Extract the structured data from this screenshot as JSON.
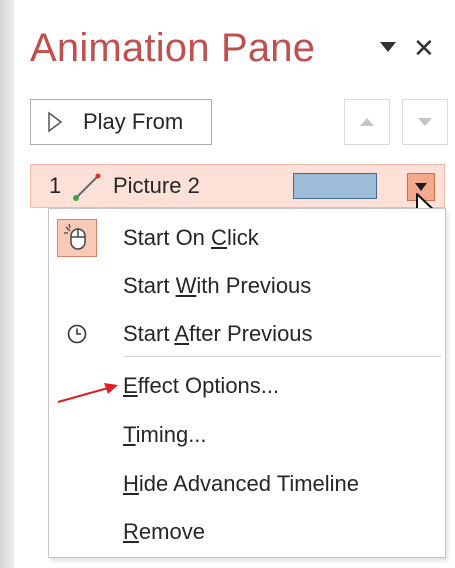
{
  "pane": {
    "title": "Animation Pane",
    "accent_color": "#c0504d"
  },
  "toolbar": {
    "play_label": "Play From",
    "move_up_icon": "triangle-up-icon",
    "move_down_icon": "triangle-down-icon"
  },
  "effect": {
    "number": "1",
    "icon": "motion-path-icon",
    "name": "Picture 2",
    "row_color": "#fde1d8",
    "timeline_color": "#9dbcd8"
  },
  "menu": {
    "items": [
      {
        "pre": "Start On ",
        "key": "C",
        "post": "lick",
        "icon": "mouse-click-icon",
        "checked": true
      },
      {
        "pre": "Start ",
        "key": "W",
        "post": "ith Previous",
        "icon": "",
        "checked": false
      },
      {
        "pre": "Start ",
        "key": "A",
        "post": "fter Previous",
        "icon": "clock-icon",
        "checked": false
      },
      {
        "pre": "",
        "key": "E",
        "post": "ffect Options...",
        "icon": "",
        "checked": false
      },
      {
        "pre": "",
        "key": "T",
        "post": "iming...",
        "icon": "",
        "checked": false
      },
      {
        "pre": "",
        "key": "H",
        "post": "ide Advanced Timeline",
        "icon": "",
        "checked": false
      },
      {
        "pre": "",
        "key": "R",
        "post": "emove",
        "icon": "",
        "checked": false
      }
    ]
  },
  "annotation": {
    "arrow_color": "#e02020"
  }
}
